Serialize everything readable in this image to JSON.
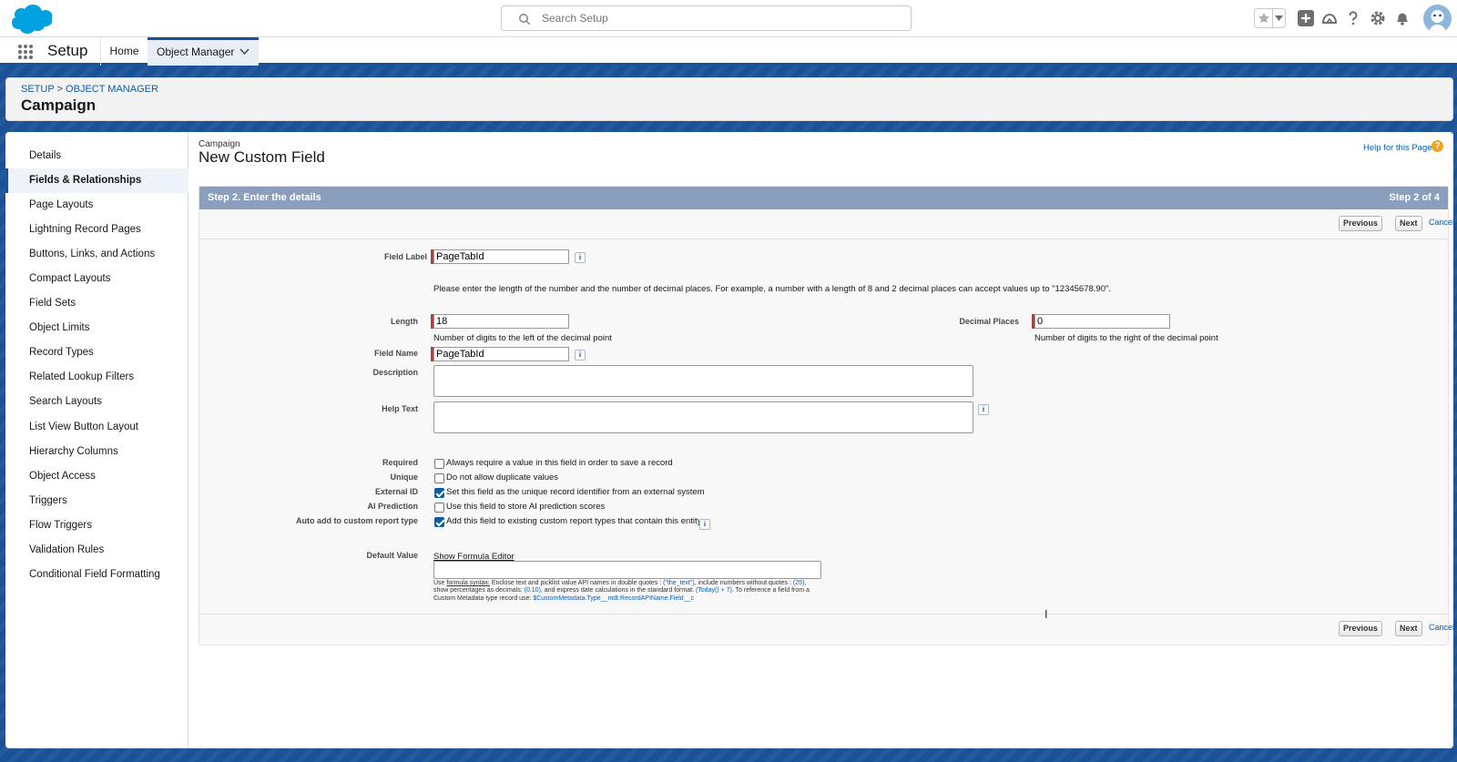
{
  "topbar": {
    "search_placeholder": "Search Setup",
    "icons": [
      "salesforce-cloud-logo",
      "search-icon",
      "star-icon",
      "chevron-down-icon",
      "plus-icon",
      "trailhead-icon",
      "question-icon",
      "gear-icon",
      "bell-icon",
      "avatar-icon"
    ]
  },
  "nav": {
    "app_name": "Setup",
    "home": "Home",
    "object_manager": "Object Manager"
  },
  "header": {
    "crumb_setup": "SETUP",
    "crumb_sep": ">",
    "crumb_om": "OBJECT MANAGER",
    "title": "Campaign"
  },
  "sidebar": {
    "items": [
      "Details",
      "Fields & Relationships",
      "Page Layouts",
      "Lightning Record Pages",
      "Buttons, Links, and Actions",
      "Compact Layouts",
      "Field Sets",
      "Object Limits",
      "Record Types",
      "Related Lookup Filters",
      "Search Layouts",
      "List View Button Layout",
      "Hierarchy Columns",
      "Object Access",
      "Triggers",
      "Flow Triggers",
      "Validation Rules",
      "Conditional Field Formatting"
    ],
    "active_index": 1
  },
  "page": {
    "object": "Campaign",
    "title": "New Custom Field",
    "help_link": "Help for this Page",
    "help_icon_char": "?"
  },
  "form": {
    "step_title": "Step 2. Enter the details",
    "step_count": "Step 2 of 4",
    "btn_previous": "Previous",
    "btn_next": "Next",
    "btn_cancel": "Cancel",
    "field_label_label": "Field Label",
    "field_label_value": "PageTabId",
    "intro_note": "Please enter the length of the number and the number of decimal places. For example, a number with a length of 8 and 2 decimal places can accept values up to \"12345678.90\".",
    "length_label": "Length",
    "length_value": "18",
    "length_note": "Number of digits to the left of the decimal point",
    "decimal_label": "Decimal Places",
    "decimal_value": "0",
    "decimal_note": "Number of digits to the right of the decimal point",
    "field_name_label": "Field Name",
    "field_name_value": "PageTabId",
    "description_label": "Description",
    "help_text_label": "Help Text",
    "required_label": "Required",
    "required_text": "Always require a value in this field in order to save a record",
    "required_checked": false,
    "unique_label": "Unique",
    "unique_text": "Do not allow duplicate values",
    "unique_checked": false,
    "external_label": "External ID",
    "external_text": "Set this field as the unique record identifier from an external system",
    "external_checked": true,
    "ai_label": "AI Prediction",
    "ai_text": "Use this field to store AI prediction scores",
    "ai_checked": false,
    "auto_label": "Auto add to custom report type",
    "auto_text": "Add this field to existing custom report types that contain this entity",
    "auto_checked": true,
    "info_char": "i",
    "default_label": "Default Value",
    "formula_editor": "Show Formula Editor",
    "hint": {
      "use": "Use ",
      "formula_syntax": "formula syntax:",
      "p1": " Enclose text and picklist value API names in double quotes : ",
      "ex_text": "(\"the_text\")",
      "p2": ", include numbers without quotes : ",
      "ex_num": "(25)",
      "p3": ", show percentages as decimals: ",
      "ex_pct": "(0.10)",
      "p4": ", and express date calculations in the standard format: ",
      "ex_date": "(Today() + 7)",
      "p5": ". To reference a field from a Custom Metadata type record use: ",
      "ex_cmt": "$CustomMetadata.Type__mdt.RecordAPIName.Field__c"
    }
  }
}
